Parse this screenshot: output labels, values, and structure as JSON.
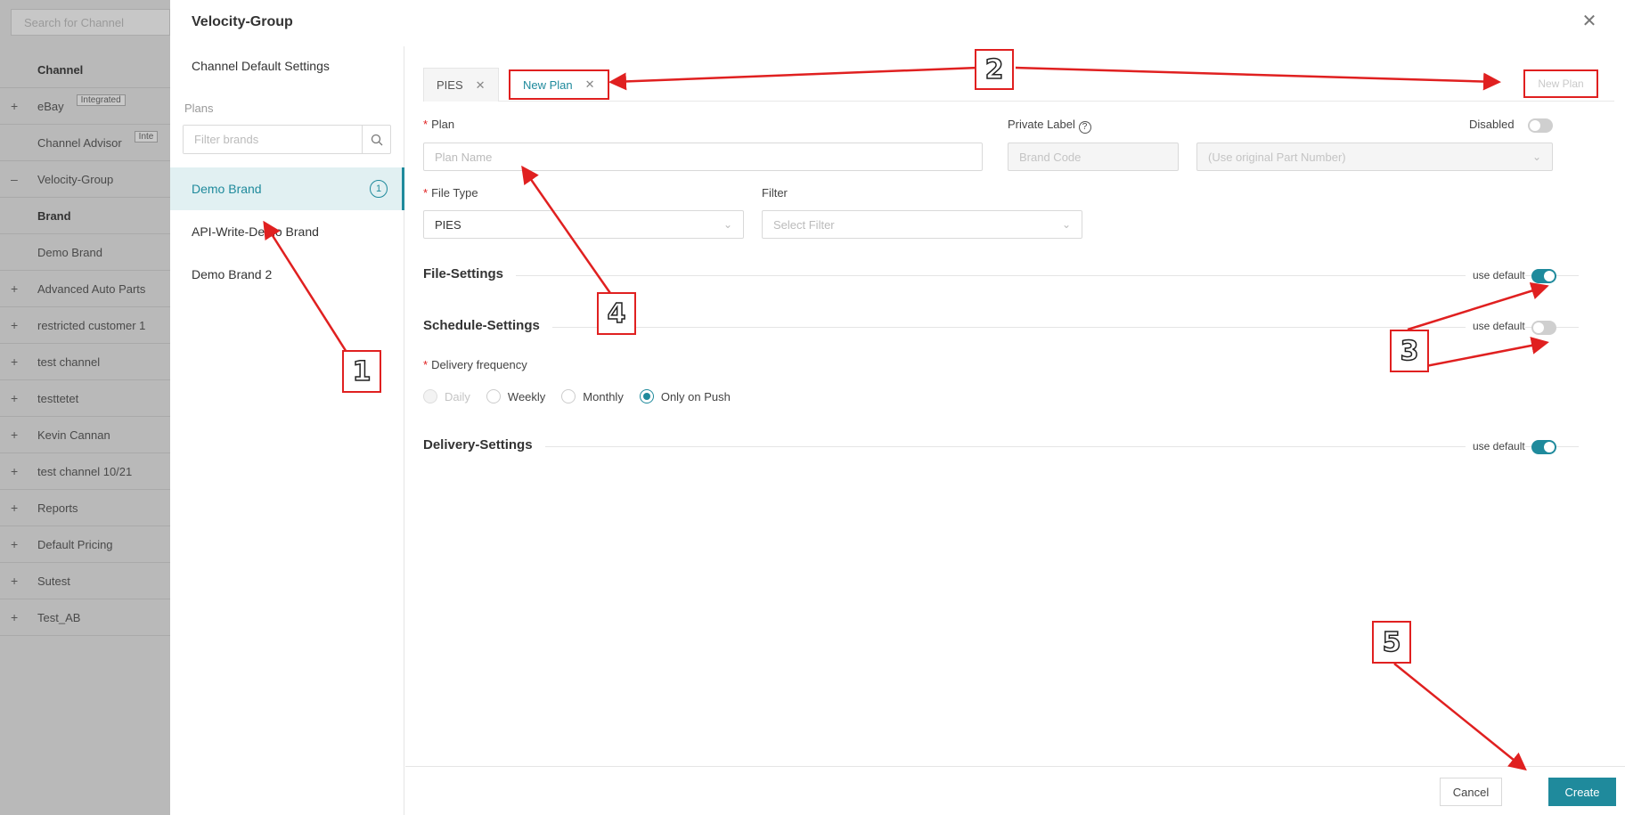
{
  "background": {
    "search_placeholder": "Search for Channel",
    "rows": [
      {
        "prefix": "",
        "label": "Channel",
        "bold": true,
        "badge": ""
      },
      {
        "prefix": "+",
        "label": "eBay",
        "bold": false,
        "badge": "Integrated"
      },
      {
        "prefix": "",
        "label": "Channel Advisor",
        "bold": false,
        "badge": "Inte"
      },
      {
        "prefix": "–",
        "label": "Velocity-Group",
        "bold": false,
        "badge": ""
      },
      {
        "prefix": "",
        "label": "Brand",
        "bold": true,
        "badge": ""
      },
      {
        "prefix": "",
        "label": "Demo Brand",
        "bold": false,
        "badge": ""
      },
      {
        "prefix": "+",
        "label": "Advanced Auto Parts",
        "bold": false,
        "badge": ""
      },
      {
        "prefix": "+",
        "label": "restricted customer 1",
        "bold": false,
        "badge": ""
      },
      {
        "prefix": "+",
        "label": "test channel",
        "bold": false,
        "badge": ""
      },
      {
        "prefix": "+",
        "label": "testtetet",
        "bold": false,
        "badge": ""
      },
      {
        "prefix": "+",
        "label": "Kevin Cannan",
        "bold": false,
        "badge": ""
      },
      {
        "prefix": "+",
        "label": "test channel 10/21",
        "bold": false,
        "badge": ""
      },
      {
        "prefix": "+",
        "label": "Reports",
        "bold": false,
        "badge": ""
      },
      {
        "prefix": "+",
        "label": "Default Pricing",
        "bold": false,
        "badge": ""
      },
      {
        "prefix": "+",
        "label": "Sutest",
        "bold": false,
        "badge": ""
      },
      {
        "prefix": "+",
        "label": "Test_AB",
        "bold": false,
        "badge": ""
      }
    ]
  },
  "drawer": {
    "title": "Velocity-Group",
    "close_icon": "close-icon"
  },
  "plans_panel": {
    "default_settings_label": "Channel Default Settings",
    "plans_label": "Plans",
    "filter_placeholder": "Filter brands",
    "brands": [
      {
        "label": "Demo Brand",
        "active": true,
        "count": "1"
      },
      {
        "label": "API-Write-Demo Brand",
        "active": false,
        "count": ""
      },
      {
        "label": "Demo Brand 2",
        "active": false,
        "count": ""
      }
    ]
  },
  "tabs": [
    {
      "label": "PIES",
      "active": false
    },
    {
      "label": "New Plan",
      "active": true
    }
  ],
  "new_plan_button": "New Plan",
  "form": {
    "plan_label": "Plan",
    "plan_placeholder": "Plan Name",
    "private_label": "Private Label",
    "disabled_label": "Disabled",
    "brand_code_placeholder": "Brand Code",
    "part_number_placeholder": "(Use original Part Number)",
    "file_type_label": "File Type",
    "file_type_value": "PIES",
    "filter_label": "Filter",
    "filter_placeholder": "Select Filter"
  },
  "sections": {
    "file_settings": {
      "title": "File-Settings",
      "use_default_label": "use default",
      "use_default": true
    },
    "schedule_settings": {
      "title": "Schedule-Settings",
      "use_default_label": "use default",
      "use_default": false
    },
    "delivery_settings": {
      "title": "Delivery-Settings",
      "use_default_label": "use default",
      "use_default": true
    }
  },
  "delivery_frequency": {
    "label": "Delivery frequency",
    "options": [
      {
        "label": "Daily",
        "disabled": true,
        "checked": false
      },
      {
        "label": "Weekly",
        "disabled": false,
        "checked": false
      },
      {
        "label": "Monthly",
        "disabled": false,
        "checked": false
      },
      {
        "label": "Only on Push",
        "disabled": false,
        "checked": true
      }
    ]
  },
  "footer": {
    "cancel_label": "Cancel",
    "create_label": "Create"
  },
  "annotations": [
    "1",
    "2",
    "3",
    "4",
    "5"
  ],
  "colors": {
    "accent": "#1f8a9c",
    "annotation_red": "#e02020"
  }
}
